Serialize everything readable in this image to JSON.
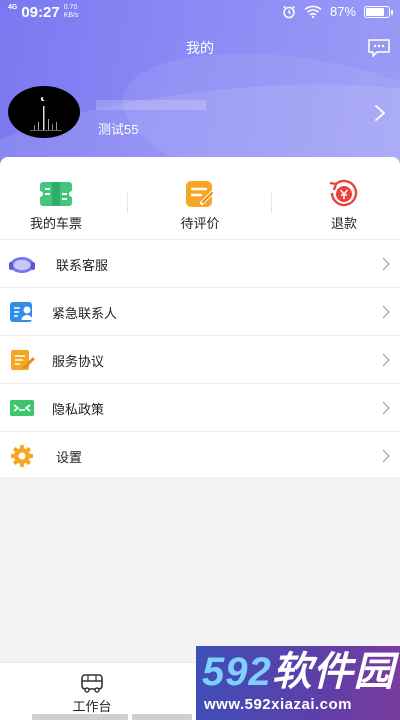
{
  "status_bar": {
    "network": "4G",
    "time": "09:27",
    "speed_value": "0.70",
    "speed_unit": "KB/s",
    "battery": "87%",
    "battery_level": 0.87
  },
  "header": {
    "title": "我的"
  },
  "profile": {
    "username": "测试55"
  },
  "quick_actions": [
    {
      "label": "我的车票",
      "icon": "ticket-icon",
      "color": "#3fc27a"
    },
    {
      "label": "待评价",
      "icon": "review-icon",
      "color": "#f5a623"
    },
    {
      "label": "退款",
      "icon": "refund-icon",
      "color": "#e8443a"
    }
  ],
  "menu": [
    {
      "label": "联系客服",
      "icon": "headset-icon"
    },
    {
      "label": "紧急联系人",
      "icon": "contact-icon"
    },
    {
      "label": "服务协议",
      "icon": "agreement-icon"
    },
    {
      "label": "隐私政策",
      "icon": "privacy-icon"
    },
    {
      "label": "设置",
      "icon": "gear-icon"
    }
  ],
  "bottom_nav": {
    "workbench_label": "工作台"
  },
  "watermark": {
    "brand": "592软件园",
    "brand_num": "592",
    "brand_text": "软件园",
    "url": "www.592xiazai.com"
  },
  "colors": {
    "header_gradient_start": "#7a78f0",
    "header_gradient_end": "#9b9cf6",
    "background": "#f3f3f5"
  }
}
